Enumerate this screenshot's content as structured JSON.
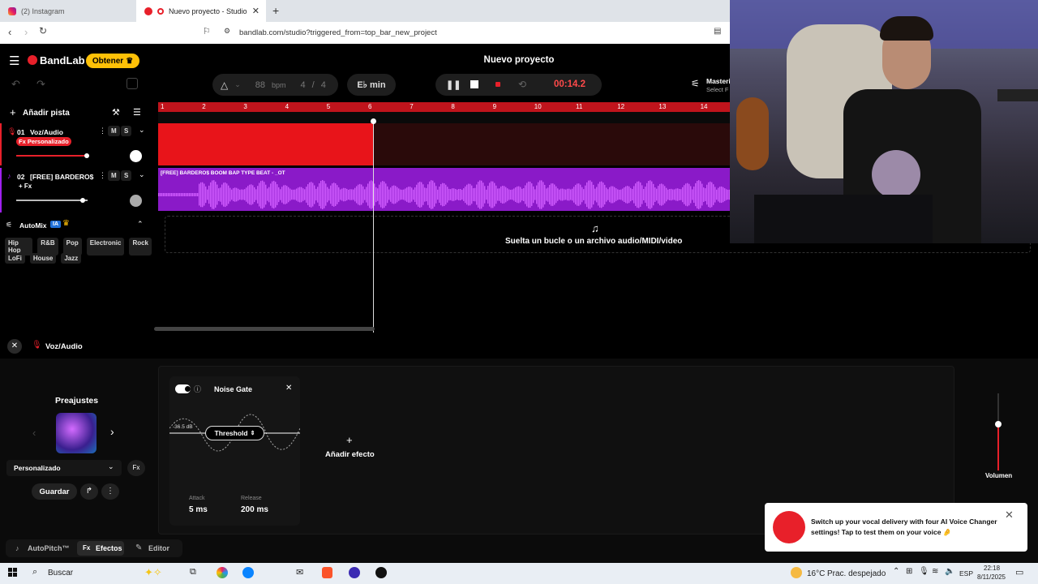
{
  "browser": {
    "tabs": [
      {
        "label": "(2) Instagram",
        "active": false
      },
      {
        "label": "Nuevo proyecto - Studio",
        "active": true
      }
    ],
    "url": "bandlab.com/studio?triggered_from=top_bar_new_project"
  },
  "app": {
    "brand": "BandLab",
    "obtener": "Obtener",
    "project_title": "Nuevo proyecto",
    "bpm_value": "88",
    "bpm_unit": "bpm",
    "time_sig_num": "4",
    "time_sig_den": "4",
    "key": "E♭ min",
    "time": "00:14.2",
    "mastering": "Masteri",
    "mastering_sub": "Select F"
  },
  "tracks_panel": {
    "add_track": "Añadir pista",
    "tracks": [
      {
        "num": "01",
        "name": "Voz/Audio",
        "fx": "Fx Personalizado",
        "mute": "M",
        "solo": "S",
        "color": "#e8202a",
        "volume": 0.85
      },
      {
        "num": "02",
        "name": "[FREE] BARDERO$ ...",
        "fx": "+ Fx",
        "mute": "M",
        "solo": "S",
        "color": "#a020f0",
        "volume": 0.82
      }
    ],
    "automix": "AutoMix",
    "automix_badge": "IA",
    "genres_row1": [
      "Hip Hop",
      "R&B",
      "Pop",
      "Electronic",
      "Rock"
    ],
    "genres_row2": [
      "LoFi",
      "House",
      "Jazz"
    ]
  },
  "timeline": {
    "ruler": [
      "1",
      "2",
      "3",
      "4",
      "5",
      "6",
      "7",
      "8",
      "9",
      "10",
      "11",
      "12",
      "13",
      "14"
    ],
    "clip2_label": "[FREE] BARDERO$ BOOM BAP TYPE BEAT - _OT",
    "drop_text": "Suelta un bucle o un archivo audio/MIDI/video"
  },
  "fx_panel": {
    "track_name": "Voz/Audio",
    "presets_title": "Preajustes",
    "preset_value": "Personalizado",
    "save": "Guardar",
    "effect_name": "Noise Gate",
    "db": "-36.5 dB",
    "threshold": "Threshold",
    "attack_label": "Attack",
    "attack_value": "5 ms",
    "release_label": "Release",
    "release_value": "200 ms",
    "add_effect": "Añadir efecto",
    "volume_label": "Volumen",
    "volume_level": 0.6
  },
  "bottom_tabs": [
    "AutoPitch™",
    "Efectos",
    "Editor"
  ],
  "toast": {
    "text": "Switch up your vocal delivery with four AI Voice Changer settings! Tap to test them on your voice 🤌"
  },
  "taskbar": {
    "search": "Buscar",
    "weather": "16°C",
    "weather_desc": "Prac. despejado",
    "lang": "ESP",
    "time": "22:18",
    "date": "8/11/2025"
  }
}
